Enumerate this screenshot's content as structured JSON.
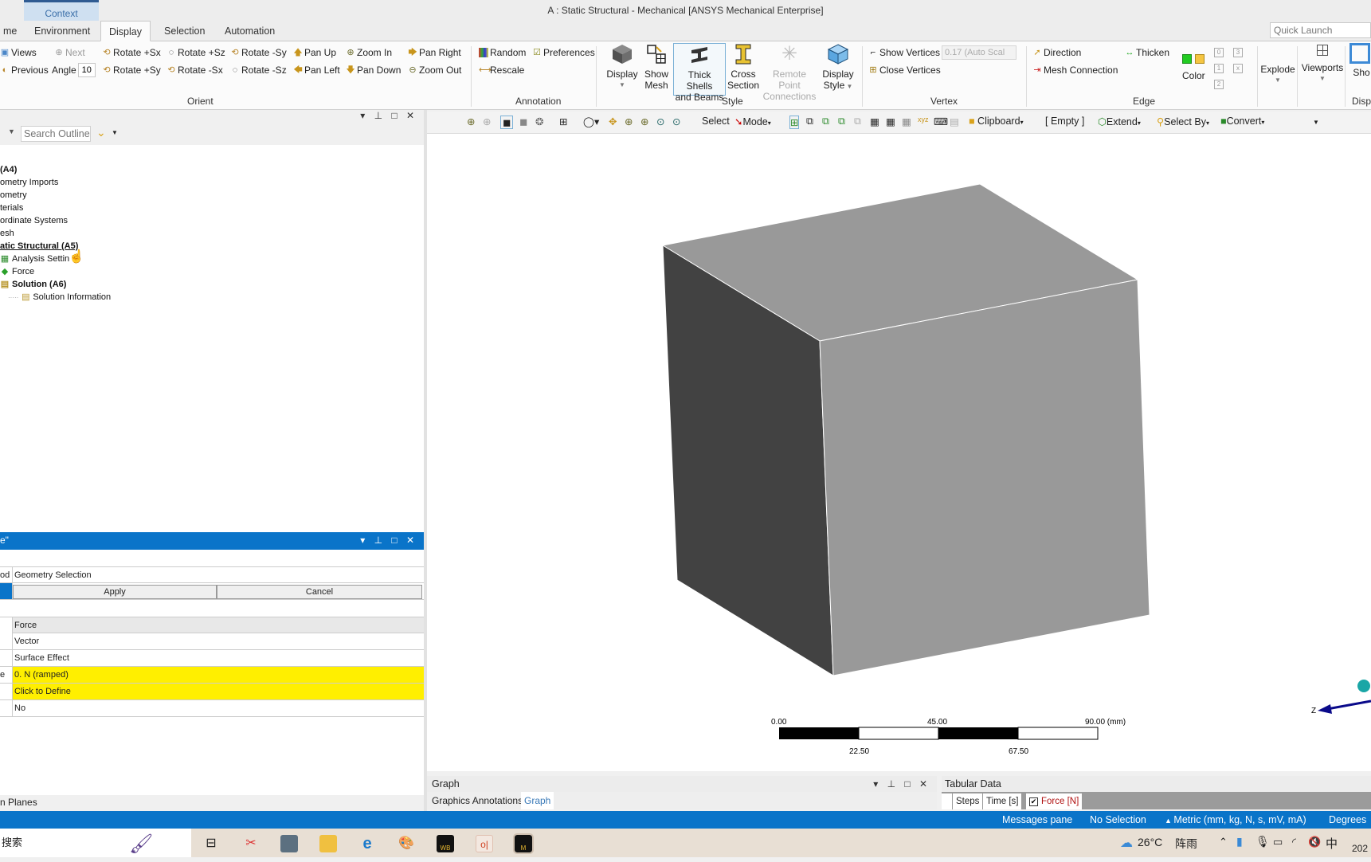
{
  "window": {
    "context_tab": "Context",
    "title": "A : Static Structural - Mechanical [ANSYS Mechanical Enterprise]"
  },
  "ribbon_tabs": [
    {
      "label": "me",
      "active": false
    },
    {
      "label": "Environment",
      "active": false
    },
    {
      "label": "Display",
      "active": true
    },
    {
      "label": "Selection",
      "active": false
    },
    {
      "label": "Automation",
      "active": false
    }
  ],
  "quick_launch": {
    "placeholder": "Quick Launch"
  },
  "orient": {
    "group_label": "Orient",
    "views": "Views",
    "next": "Next",
    "previous": "Previous",
    "angle_label": "Angle",
    "angle_value": "10",
    "rotate_pos_sx": "Rotate +Sx",
    "rotate_pos_sz": "Rotate +Sz",
    "rotate_neg_sy": "Rotate -Sy",
    "rotate_pos_sy": "Rotate +Sy",
    "rotate_neg_sx": "Rotate -Sx",
    "rotate_neg_sz": "Rotate -Sz",
    "pan_up": "Pan Up",
    "pan_left": "Pan Left",
    "pan_down": "Pan Down",
    "pan_right": "Pan Right",
    "zoom_in": "Zoom In",
    "zoom_out": "Zoom Out"
  },
  "annotation": {
    "group_label": "Annotation",
    "random": "Random",
    "preferences": "Preferences",
    "rescale": "Rescale"
  },
  "style": {
    "group_label": "Style",
    "display": "Display",
    "show_mesh_1": "Show",
    "show_mesh_2": "Mesh",
    "thick_1": "Thick Shells",
    "thick_2": "and Beams",
    "cross_1": "Cross",
    "cross_2": "Section",
    "remote_1": "Remote Point",
    "remote_2": "Connections",
    "display_style_1": "Display",
    "display_style_2": "Style"
  },
  "vertex": {
    "group_label": "Vertex",
    "show_vertices": "Show Vertices",
    "scale_value": "0.17 (Auto Scal",
    "close_vertices": "Close Vertices"
  },
  "edge": {
    "group_label": "Edge",
    "direction": "Direction",
    "thicken": "Thicken",
    "mesh_connection": "Mesh Connection",
    "color": "Color",
    "small_buttons": [
      "0",
      "1",
      "2",
      "3",
      "x"
    ]
  },
  "display_group": {
    "explode": "Explode",
    "viewports": "Viewports",
    "show": "Sho",
    "group_label": "Disp"
  },
  "outline": {
    "search_placeholder": "Search Outline",
    "items": [
      {
        "label": "(A4)",
        "bold": true
      },
      {
        "label": "ometry Imports"
      },
      {
        "label": "ometry"
      },
      {
        "label": "terials"
      },
      {
        "label": "ordinate Systems"
      },
      {
        "label": "esh"
      },
      {
        "label": "atic Structural (A5)",
        "bold": true,
        "underline": true
      },
      {
        "label": "Analysis Settin"
      },
      {
        "label": "Force"
      },
      {
        "label": "Solution (A6)",
        "bold": true
      },
      {
        "label": "Solution Information"
      }
    ]
  },
  "details": {
    "title": "e\"",
    "rows": [
      {
        "key": "od",
        "value": "Geometry Selection"
      },
      {
        "apply": "Apply",
        "cancel": "Cancel"
      },
      {
        "key": "",
        "value": "Force",
        "style": "gray"
      },
      {
        "key": "",
        "value": "Vector"
      },
      {
        "key": "",
        "value": "Surface Effect"
      },
      {
        "key": "e",
        "value": "0. N  (ramped)",
        "style": "yellow"
      },
      {
        "key": "",
        "value": "Click to Define",
        "style": "yellow"
      },
      {
        "key": "",
        "value": "No"
      }
    ]
  },
  "bottom_left_tab": "n Planes",
  "view_toolbar": {
    "select": "Select",
    "mode": "Mode",
    "clipboard": "Clipboard",
    "empty": "[ Empty ]",
    "extend": "Extend",
    "select_by": "Select By",
    "convert": "Convert"
  },
  "scale_bar": {
    "labels_top": [
      "0.00",
      "45.00",
      "90.00 (mm)"
    ],
    "labels_bottom": [
      "22.50",
      "67.50"
    ]
  },
  "triad": {
    "z_label": "Z"
  },
  "graph": {
    "title": "Graph",
    "tabs": [
      "Graphics Annotations",
      "Graph"
    ]
  },
  "tabular": {
    "title": "Tabular Data",
    "columns": [
      "Steps",
      "Time [s]",
      "Force [N]"
    ]
  },
  "status": {
    "messages": "Messages pane",
    "selection": "No Selection",
    "units": "Metric (mm, kg, N, s, mV, mA)",
    "angle": "Degrees"
  },
  "taskbar": {
    "search": "搜索",
    "weather_temp": "26°C",
    "weather_text": "阵雨",
    "ime": "中",
    "clock": "202",
    "apps": [
      "task-view",
      "snipping-tool",
      "calculator",
      "file-explorer",
      "internet-explorer",
      "paint",
      "workbench",
      "office",
      "mechanical"
    ]
  },
  "colors": {
    "accent": "#0a74c9",
    "yellow_row": "#ffef00",
    "cube_light": "#999999",
    "cube_dark": "#424242"
  }
}
